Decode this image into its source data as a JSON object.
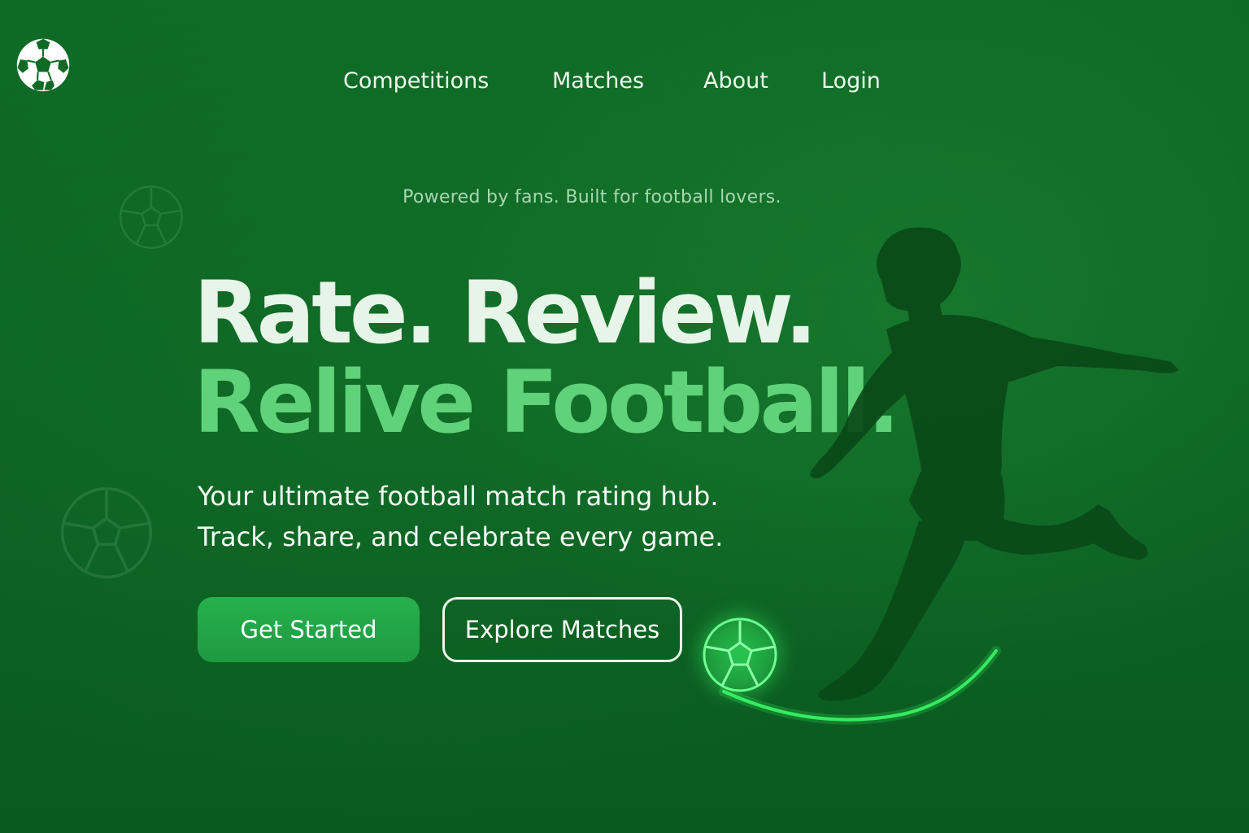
{
  "brand": {
    "logo_icon": "soccer-ball-icon"
  },
  "nav": {
    "items": [
      {
        "label": "Competitions"
      },
      {
        "label": "Matches"
      },
      {
        "label": "About"
      },
      {
        "label": "Login"
      }
    ]
  },
  "hero": {
    "tagline": "Powered by fans. Built for football lovers.",
    "headline_line1": "Rate. Review.",
    "headline_line2": "Relive Football.",
    "subtitle_line1": "Your ultimate football match rating hub.",
    "subtitle_line2": "Track, share, and celebrate every game.",
    "primary_cta": "Get Started",
    "secondary_cta": "Explore Matches"
  },
  "colors": {
    "background": "#0c6323",
    "accent_green": "#5fd27a",
    "button_green": "#22a547",
    "glow": "#3dff6b",
    "silhouette": "#0a4a18"
  },
  "illustration": {
    "hero_image": "football-player-kicking-silhouette",
    "ball_icon": "glowing-soccer-ball-icon"
  }
}
